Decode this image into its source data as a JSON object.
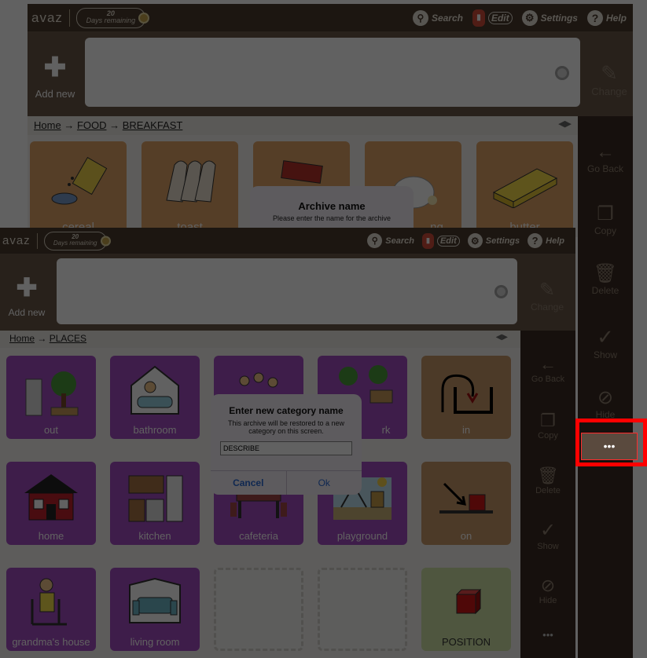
{
  "back_screen": {
    "logo": "avaz",
    "trial": {
      "days": "20",
      "label": "Days remaining"
    },
    "toolbar": {
      "search": "Search",
      "edit": "Edit",
      "settings": "Settings",
      "help": "Help"
    },
    "add_new": "Add new",
    "change": "Change",
    "breadcrumb": {
      "home": "Home",
      "arrow": "→",
      "items": [
        "FOOD",
        "BREAKFAST"
      ]
    },
    "tiles": [
      "cereal",
      "toast",
      "",
      "ng",
      "butter"
    ],
    "dialog": {
      "title": "Archive name",
      "message": "Please enter the name for the archive"
    },
    "sidebar": [
      "Go Back",
      "Copy",
      "Delete",
      "Show",
      "Hide",
      "•••"
    ]
  },
  "front_screen": {
    "logo": "avaz",
    "trial": {
      "days": "20",
      "label": "Days remaining"
    },
    "toolbar": {
      "search": "Search",
      "edit": "Edit",
      "settings": "Settings",
      "help": "Help"
    },
    "add_new": "Add new",
    "change": "Change",
    "breadcrumb": {
      "home": "Home",
      "arrow": "→",
      "items": [
        "PLACES"
      ]
    },
    "tiles": [
      [
        "out",
        "bathroom",
        "",
        "rk",
        "in"
      ],
      [
        "home",
        "kitchen",
        "cafeteria",
        "playground",
        "on"
      ],
      [
        "grandma's house",
        "living room",
        "",
        "",
        "POSITION"
      ]
    ],
    "sidebar": [
      "Go Back",
      "Copy",
      "Delete",
      "Show",
      "Hide",
      "•••"
    ],
    "dialog": {
      "title": "Enter new category name",
      "message": "This archive will be restored to a new category on this screen.",
      "input_value": "DESCRIBE",
      "cancel": "Cancel",
      "ok": "Ok"
    }
  },
  "highlight": {
    "more_label": "•••"
  }
}
